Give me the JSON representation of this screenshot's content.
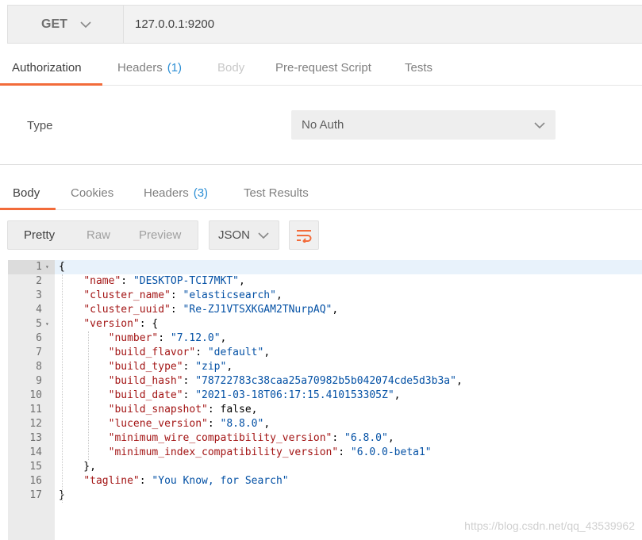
{
  "request": {
    "method": "GET",
    "url": "127.0.0.1:9200"
  },
  "request_tabs": [
    {
      "label": "Authorization",
      "count": "",
      "state": "active"
    },
    {
      "label": "Headers",
      "count": "(1)",
      "state": "normal"
    },
    {
      "label": "Body",
      "count": "",
      "state": "disabled"
    },
    {
      "label": "Pre-request Script",
      "count": "",
      "state": "normal"
    },
    {
      "label": "Tests",
      "count": "",
      "state": "normal"
    }
  ],
  "auth": {
    "type_label": "Type",
    "selected": "No Auth"
  },
  "response_tabs": [
    {
      "label": "Body",
      "count": "",
      "state": "active"
    },
    {
      "label": "Cookies",
      "count": "",
      "state": "normal"
    },
    {
      "label": "Headers",
      "count": "(3)",
      "state": "normal"
    },
    {
      "label": "Test Results",
      "count": "",
      "state": "normal"
    }
  ],
  "view_modes": [
    "Pretty",
    "Raw",
    "Preview"
  ],
  "active_view": "Pretty",
  "format": "JSON",
  "icons": {
    "method_dropdown": "chevron-down-icon",
    "auth_dropdown": "chevron-down-icon",
    "format_dropdown": "chevron-down-icon",
    "wrap": "wrap-lines-icon",
    "fold": "fold-arrow-icon"
  },
  "colors": {
    "accent": "#f26b3a",
    "count": "#2d8fd5",
    "json_key": "#a31515",
    "json_string": "#0451a5"
  },
  "code_lines": [
    {
      "n": "1",
      "text": "{"
    },
    {
      "n": "2",
      "text": "    \"name\": \"DESKTOP-TCI7MKT\","
    },
    {
      "n": "3",
      "text": "    \"cluster_name\": \"elasticsearch\","
    },
    {
      "n": "4",
      "text": "    \"cluster_uuid\": \"Re-ZJ1VTSXKGAM2TNurpAQ\","
    },
    {
      "n": "5",
      "text": "    \"version\": {"
    },
    {
      "n": "6",
      "text": "        \"number\": \"7.12.0\","
    },
    {
      "n": "7",
      "text": "        \"build_flavor\": \"default\","
    },
    {
      "n": "8",
      "text": "        \"build_type\": \"zip\","
    },
    {
      "n": "9",
      "text": "        \"build_hash\": \"78722783c38caa25a70982b5b042074cde5d3b3a\","
    },
    {
      "n": "10",
      "text": "        \"build_date\": \"2021-03-18T06:17:15.410153305Z\","
    },
    {
      "n": "11",
      "text": "        \"build_snapshot\": false,"
    },
    {
      "n": "12",
      "text": "        \"lucene_version\": \"8.8.0\","
    },
    {
      "n": "13",
      "text": "        \"minimum_wire_compatibility_version\": \"6.8.0\","
    },
    {
      "n": "14",
      "text": "        \"minimum_index_compatibility_version\": \"6.0.0-beta1\""
    },
    {
      "n": "15",
      "text": "    },"
    },
    {
      "n": "16",
      "text": "    \"tagline\": \"You Know, for Search\""
    },
    {
      "n": "17",
      "text": "}"
    }
  ],
  "watermark": "https://blog.csdn.net/qq_43539962"
}
